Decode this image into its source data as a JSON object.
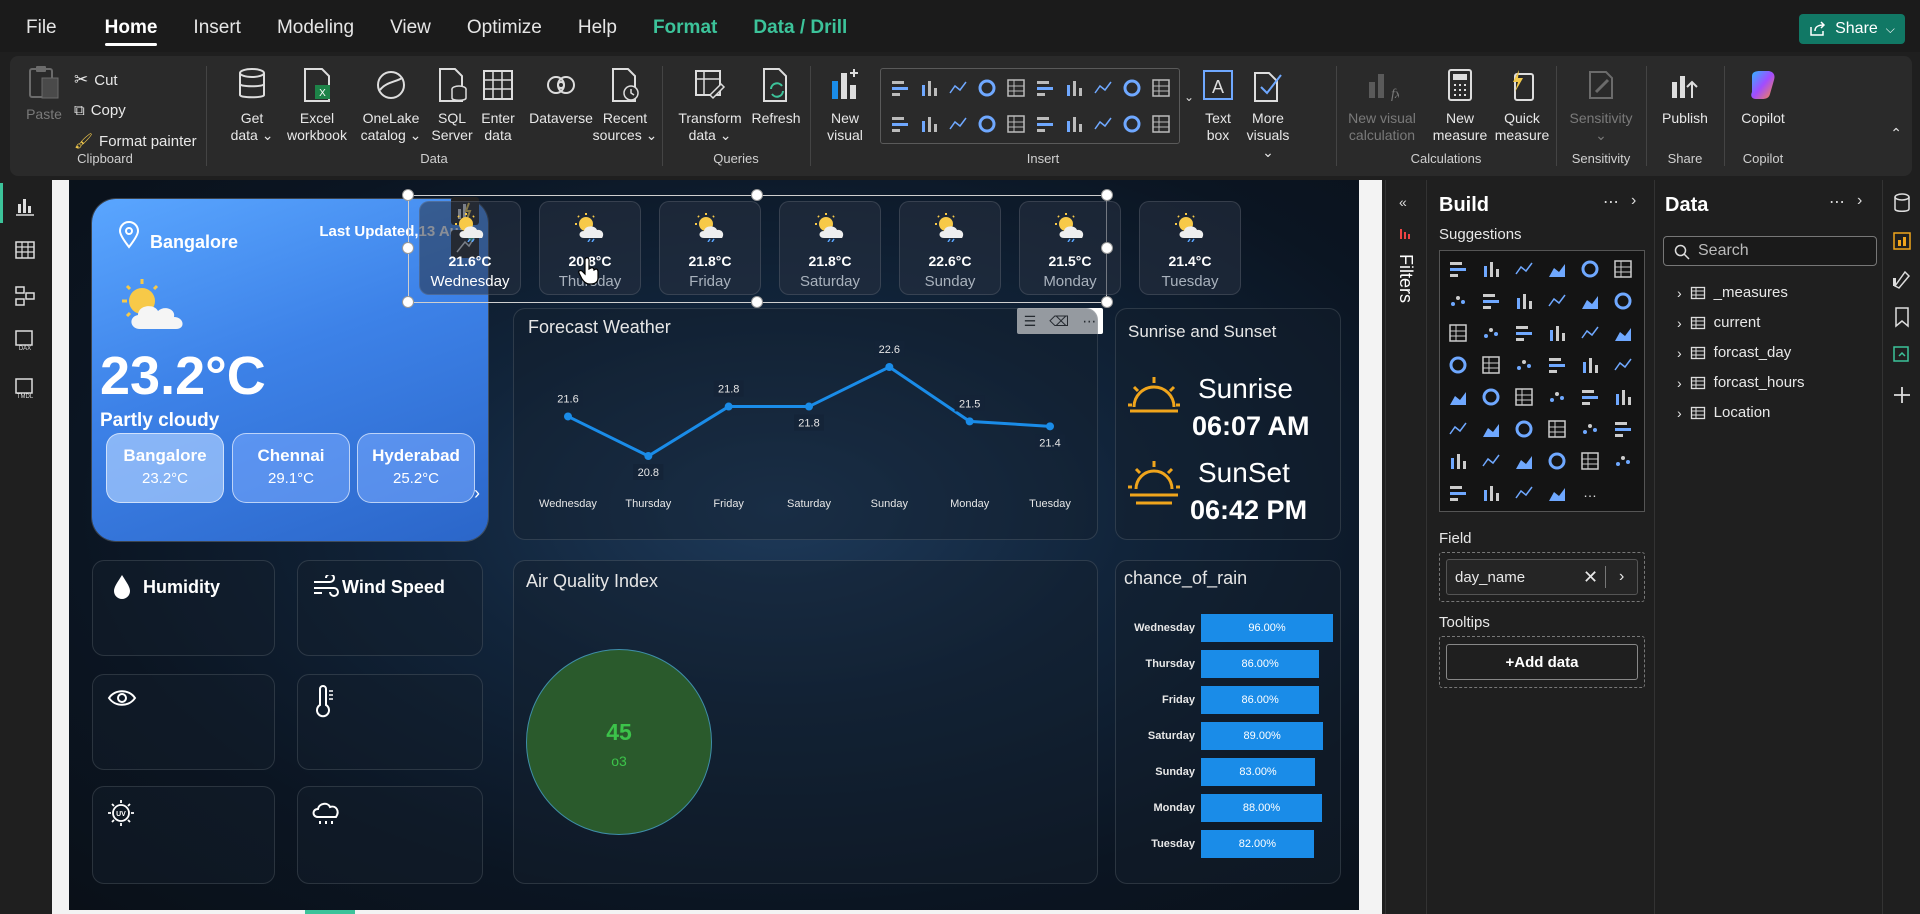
{
  "menu": {
    "items": [
      "File",
      "Home",
      "Insert",
      "Modeling",
      "View",
      "Optimize",
      "Help",
      "Format",
      "Data / Drill"
    ],
    "share_label": "Share"
  },
  "ribbon": {
    "clipboard": {
      "paste": "Paste",
      "cut": "Cut",
      "copy": "Copy",
      "format_painter": "Format painter",
      "label": "Clipboard"
    },
    "data": {
      "get_data": [
        "Get",
        "data"
      ],
      "excel": [
        "Excel",
        "workbook"
      ],
      "onelake": [
        "OneLake",
        "catalog"
      ],
      "sql": [
        "SQL",
        "Server"
      ],
      "enter": [
        "Enter",
        "data"
      ],
      "dataverse": [
        "Dataverse"
      ],
      "recent": [
        "Recent",
        "sources"
      ],
      "label": "Data"
    },
    "queries": {
      "transform": [
        "Transform",
        "data"
      ],
      "refresh": [
        "Refresh"
      ],
      "label": "Queries"
    },
    "insert": {
      "new_visual": [
        "New",
        "visual"
      ],
      "text_box": [
        "Text",
        "box"
      ],
      "more_visuals": [
        "More",
        "visuals"
      ],
      "label": "Insert"
    },
    "calculations": {
      "new_visual_calc": [
        "New visual",
        "calculation"
      ],
      "new_measure": [
        "New",
        "measure"
      ],
      "quick_measure": [
        "Quick",
        "measure"
      ],
      "label": "Calculations"
    },
    "sensitivity": {
      "sensitivity": [
        "Sensitivity"
      ],
      "label": "Sensitivity"
    },
    "share": {
      "publish": [
        "Publish"
      ],
      "label": "Share"
    },
    "copilot": {
      "copilot": [
        "Copilot"
      ],
      "label": "Copilot"
    }
  },
  "report": {
    "main": {
      "city": "Bangalore",
      "updated": "Last Updated,13 Aug",
      "temp": "23.2°C",
      "condition": "Partly cloudy",
      "cities": [
        {
          "name": "Bangalore",
          "temp": "23.2°C"
        },
        {
          "name": "Chennai",
          "temp": "29.1°C"
        },
        {
          "name": "Hyderabad",
          "temp": "25.2°C"
        }
      ]
    },
    "days": [
      {
        "temp": "21.6°C",
        "name": "Wednesday"
      },
      {
        "temp": "20.8°C",
        "name": "Thursday"
      },
      {
        "temp": "21.8°C",
        "name": "Friday"
      },
      {
        "temp": "21.8°C",
        "name": "Saturday"
      },
      {
        "temp": "22.6°C",
        "name": "Sunday"
      },
      {
        "temp": "21.5°C",
        "name": "Monday"
      },
      {
        "temp": "21.4°C",
        "name": "Tuesday"
      }
    ],
    "forecast_title": "Forecast Weather",
    "sun": {
      "title": "Sunrise and Sunset",
      "sunrise_label": "Sunrise",
      "sunrise": "06:07 AM",
      "sunset_label": "SunSet",
      "sunset": "06:42 PM"
    },
    "humidity": "Humidity",
    "wind": "Wind Speed",
    "aqi": {
      "title": "Air Quality Index",
      "value": "45",
      "label": "o3"
    },
    "rain": {
      "title": "chance_of_rain",
      "rows": [
        {
          "day": "Wednesday",
          "value": 96,
          "label": "96.00%"
        },
        {
          "day": "Thursday",
          "value": 86,
          "label": "86.00%"
        },
        {
          "day": "Friday",
          "value": 86,
          "label": "86.00%"
        },
        {
          "day": "Saturday",
          "value": 89,
          "label": "89.00%"
        },
        {
          "day": "Sunday",
          "value": 83,
          "label": "83.00%"
        },
        {
          "day": "Monday",
          "value": 88,
          "label": "88.00%"
        },
        {
          "day": "Tuesday",
          "value": 82,
          "label": "82.00%"
        }
      ]
    }
  },
  "chart_data": {
    "type": "line",
    "categories": [
      "Wednesday",
      "Thursday",
      "Friday",
      "Saturday",
      "Sunday",
      "Monday",
      "Tuesday"
    ],
    "values": [
      21.6,
      20.8,
      21.8,
      21.8,
      22.6,
      21.5,
      21.4
    ],
    "title": "Forecast Weather",
    "ylim": [
      20.5,
      23
    ],
    "color": "#1a8ce8"
  },
  "filters_label": "Filters",
  "build": {
    "title": "Build",
    "suggestions": "Suggestions",
    "field_label": "Field",
    "field_value": "day_name",
    "tooltips_label": "Tooltips",
    "add_data": "+Add data"
  },
  "datapane": {
    "title": "Data",
    "search_placeholder": "Search",
    "tables": [
      "_measures",
      "current",
      "forcast_day",
      "forcast_hours",
      "Location"
    ]
  },
  "colors": {
    "accent": "#117865",
    "green": "#3cc39a",
    "line": "#1a8ce8",
    "card_blue": "#3d82e8"
  }
}
